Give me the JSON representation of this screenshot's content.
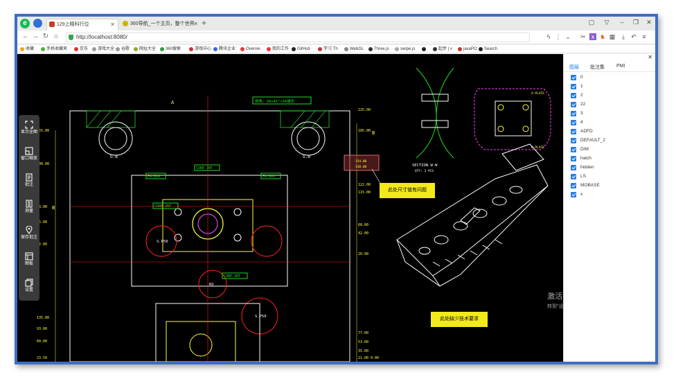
{
  "browser": {
    "logo_letter": "e",
    "tabs": [
      {
        "title": "129上精科行位",
        "active": true,
        "favicon_color": "#c83a2c"
      },
      {
        "title": "360导航_一个主页，整个世界",
        "active": false,
        "favicon_color": "#c9b400"
      }
    ],
    "url": "http://localhost:8080/",
    "window_controls": [
      "minimize-icon",
      "maximize-icon",
      "close-icon"
    ],
    "bookmarks": [
      {
        "label": "收藏",
        "color": "#f2a516"
      },
      {
        "label": "手机收藏夹",
        "color": "#52b043"
      },
      {
        "label": "京东",
        "color": "#d33"
      },
      {
        "label": "游戏大全",
        "color": "#999"
      },
      {
        "label": "谷歌",
        "color": "#999"
      },
      {
        "label": "网址大全",
        "color": "#8a3"
      },
      {
        "label": "360搜索",
        "color": "#2a9d3c"
      },
      {
        "label": "游戏中心",
        "color": "#c33"
      },
      {
        "label": "腾讯企业",
        "color": "#2d6bd6"
      },
      {
        "label": "Overvie",
        "color": "#e33"
      },
      {
        "label": "我的工作",
        "color": "#e33"
      },
      {
        "label": "GitHub",
        "color": "#222"
      },
      {
        "label": "学习 Th",
        "color": "#c33"
      },
      {
        "label": "WebGL",
        "color": "#888"
      },
      {
        "label": "Three.js",
        "color": "#333"
      },
      {
        "label": "swipe.js",
        "color": "#aaa"
      },
      {
        "label": "",
        "color": "#222"
      },
      {
        "label": "起步 | v",
        "color": "#333"
      },
      {
        "label": "javaPO",
        "color": "#c33"
      },
      {
        "label": "Search",
        "color": "#222"
      }
    ]
  },
  "toolbar": {
    "items": [
      {
        "label": "显示全图",
        "icon": "fit-view-icon"
      },
      {
        "label": "窗口缩放",
        "icon": "window-zoom-icon"
      },
      {
        "label": "批注",
        "icon": "annotation-icon"
      },
      {
        "label": "测量",
        "icon": "measure-icon"
      },
      {
        "label": "保存批注",
        "icon": "save-annotation-icon"
      },
      {
        "label": "图板",
        "icon": "drawing-board-icon"
      },
      {
        "label": "设置",
        "icon": "settings-icon"
      }
    ]
  },
  "notes": {
    "size_issue": "此处尺寸值有问题",
    "missing_tech": "此处缺少技术要求"
  },
  "drawing": {
    "chamfer_label": "倒角：30×45°×56锥形",
    "section_label": "SECTION W-W",
    "section_sub": "QTY: 3 PCS",
    "left_dims": [
      "155.00",
      "130.00",
      "98.00",
      "75.00",
      "42.00",
      "135.00",
      "93.00",
      "60.00",
      "23.50"
    ],
    "right_dims": [
      "225.00",
      "185.00",
      "154.00",
      "130.00",
      "122.00",
      "115.00",
      "68.00",
      "42.00",
      "20.00",
      "77.00",
      "53.00",
      "35.00",
      "21.00",
      "0.00"
    ],
    "box_dims": [
      "154.00",
      "130.00"
    ],
    "labels": [
      "G.B",
      "G.B",
      "CORE-INT",
      "CORE-INT",
      "CORE-INT",
      "S.P50",
      "S.P50",
      "KO",
      "EG-B09",
      "EG-B09"
    ],
    "markers": [
      "A",
      "B",
      "B"
    ],
    "plates": [
      "A-PLATE",
      "B-PLATE"
    ]
  },
  "layer_panel": {
    "tabs": [
      "图层",
      "批注集",
      "PMI"
    ],
    "active_tab": 0,
    "layers": [
      "0",
      "1",
      "2",
      "22",
      "3",
      "4",
      "ADFD",
      "DEFAULT_2",
      "DIM",
      "hatch",
      "hidden",
      "LS",
      "MOBASE",
      "x"
    ]
  },
  "os_watermark": {
    "title": "激活 Windows",
    "subtitle": "转到\"设置\"以激活 Windows。"
  }
}
